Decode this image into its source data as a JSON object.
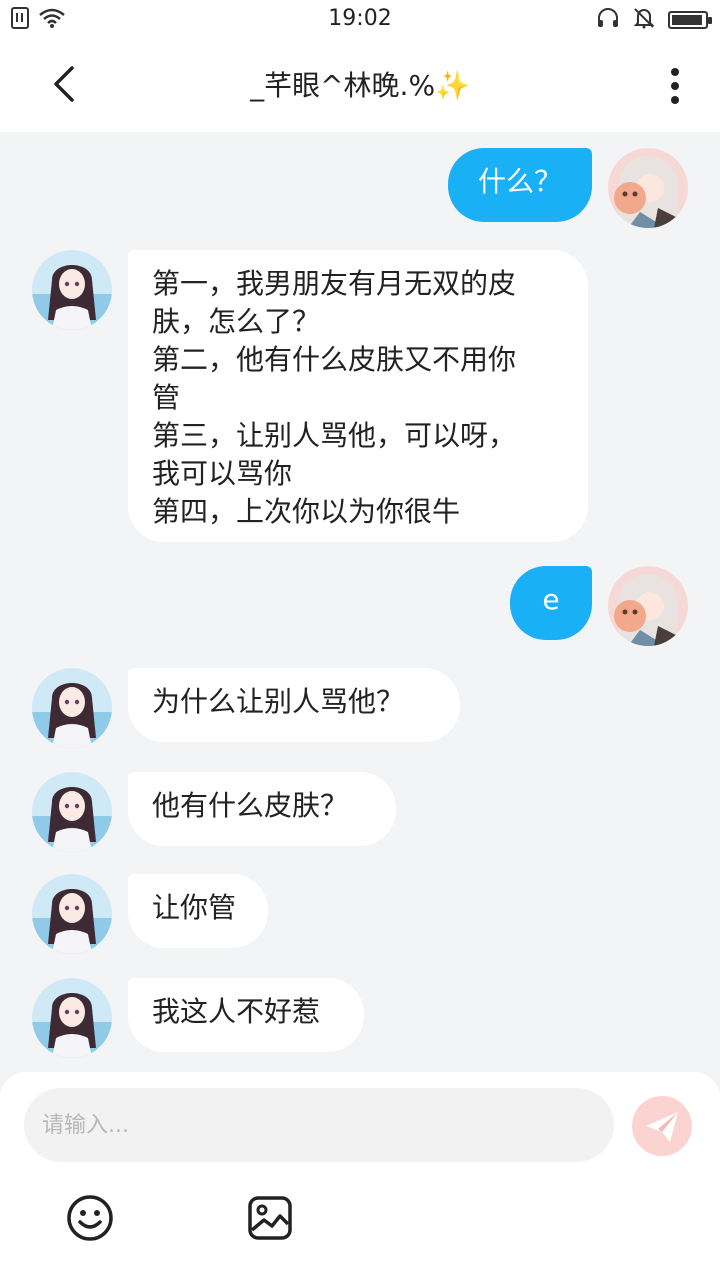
{
  "status_bar": {
    "time": "19:02",
    "icons": [
      "sim-icon",
      "wifi-icon",
      "headset-icon",
      "mute-icon",
      "battery-icon"
    ]
  },
  "header": {
    "title": "_芊眼^林晚.%✨",
    "back_icon": "chevron-left-icon",
    "more_icon": "more-vertical-icon"
  },
  "messages": [
    {
      "sender": "me",
      "text": "什么？"
    },
    {
      "sender": "other",
      "lines": [
        "第一，我男朋友有月无双的皮",
        "肤，怎么了？",
        "第二，他有什么皮肤又不用你",
        "管",
        "第三，让别人骂他，可以呀，",
        "我可以骂你",
        "第四，上次你以为你很牛"
      ]
    },
    {
      "sender": "me",
      "text": "e"
    },
    {
      "sender": "other",
      "text": "为什么让别人骂他？"
    },
    {
      "sender": "other",
      "text": "他有什么皮肤？"
    },
    {
      "sender": "other",
      "text": "让你管"
    },
    {
      "sender": "other",
      "text": "我这人不好惹"
    }
  ],
  "input": {
    "placeholder": "请输入...",
    "send_icon": "paper-plane-icon"
  },
  "toolbar": {
    "emoji_icon": "smiley-icon",
    "image_icon": "image-icon"
  },
  "colors": {
    "accent": "#1ab0f5",
    "background": "#f3f4f6",
    "send_button": "#fbd3d0"
  }
}
